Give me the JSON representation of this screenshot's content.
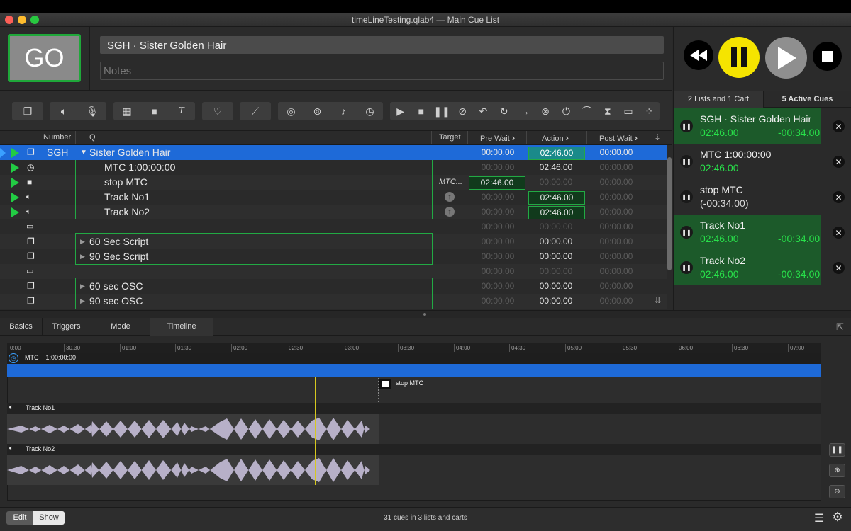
{
  "window": {
    "title": "timeLineTesting.qlab4 — Main Cue List"
  },
  "header": {
    "go_label": "GO",
    "cue_name": "SGH · Sister Golden Hair",
    "notes_placeholder": "Notes"
  },
  "columns": {
    "number": "Number",
    "q": "Q",
    "target": "Target",
    "pre_wait": "Pre Wait",
    "action": "Action",
    "post_wait": "Post Wait"
  },
  "cues": [
    {
      "number": "SGH",
      "name": "Sister Golden Hair",
      "target": "",
      "pre": "00:00.00",
      "action": "02:46.00",
      "post": "00:00.00"
    },
    {
      "number": "",
      "name": "MTC    1:00:00:00",
      "target": "",
      "pre": "00:00.00",
      "action": "02:46.00",
      "post": "00:00.00"
    },
    {
      "number": "",
      "name": "stop MTC",
      "target": "MTC...",
      "pre": "02:46.00",
      "action": "00:00.00",
      "post": "00:00.00"
    },
    {
      "number": "",
      "name": "Track No1",
      "target": "",
      "pre": "00:00.00",
      "action": "02:46.00",
      "post": "00:00.00"
    },
    {
      "number": "",
      "name": "Track No2",
      "target": "",
      "pre": "00:00.00",
      "action": "02:46.00",
      "post": "00:00.00"
    },
    {
      "number": "",
      "name": "",
      "target": "",
      "pre": "00:00.00",
      "action": "00:00.00",
      "post": "00:00.00"
    },
    {
      "number": "",
      "name": "60 Sec Script",
      "target": "",
      "pre": "00:00.00",
      "action": "00:00.00",
      "post": "00:00.00"
    },
    {
      "number": "",
      "name": "90 Sec Script",
      "target": "",
      "pre": "00:00.00",
      "action": "00:00.00",
      "post": "00:00.00"
    },
    {
      "number": "",
      "name": "",
      "target": "",
      "pre": "00:00.00",
      "action": "00:00.00",
      "post": "00:00.00"
    },
    {
      "number": "",
      "name": "60 sec OSC",
      "target": "",
      "pre": "00:00.00",
      "action": "00:00.00",
      "post": "00:00.00"
    },
    {
      "number": "",
      "name": "90 sec OSC",
      "target": "",
      "pre": "00:00.00",
      "action": "00:00.00",
      "post": "00:00.00"
    }
  ],
  "right_panel": {
    "tab_lists": "2 Lists and 1 Cart",
    "tab_active": "5 Active Cues",
    "active_cues": [
      {
        "name": "SGH · Sister Golden Hair",
        "elapsed": "02:46.00",
        "remaining": "-00:34.00",
        "progress": 0.83
      },
      {
        "name": "MTC    1:00:00:00",
        "elapsed": "02:46.00",
        "remaining": "",
        "progress": 0
      },
      {
        "name": "stop MTC",
        "elapsed": "(-00:34.00)",
        "remaining": "",
        "progress": 0
      },
      {
        "name": "Track No1",
        "elapsed": "02:46.00",
        "remaining": "-00:34.00",
        "progress": 0.83
      },
      {
        "name": "Track No2",
        "elapsed": "02:46.00",
        "remaining": "-00:34.00",
        "progress": 0.83
      }
    ]
  },
  "inspector": {
    "tabs": [
      "Basics",
      "Triggers",
      "Mode",
      "Timeline"
    ],
    "active_tab": "Timeline",
    "ruler_ticks": [
      "0:00",
      "30.30",
      "01:00",
      "01:30",
      "02:00",
      "02:30",
      "03:00",
      "03:30",
      "04:00",
      "04:30",
      "05:00",
      "05:30",
      "06:00",
      "06:30",
      "07:00"
    ],
    "tracks": {
      "mtc": "MTC    1:00:00:00",
      "stop": "stop MTC",
      "track1": "Track No1",
      "track2": "Track No2"
    }
  },
  "footer": {
    "edit": "Edit",
    "show": "Show",
    "status": "31 cues in 3 lists and carts"
  },
  "colors": {
    "accent": "#1e6ad8",
    "green": "#22cc44",
    "pause": "#f5e400"
  }
}
